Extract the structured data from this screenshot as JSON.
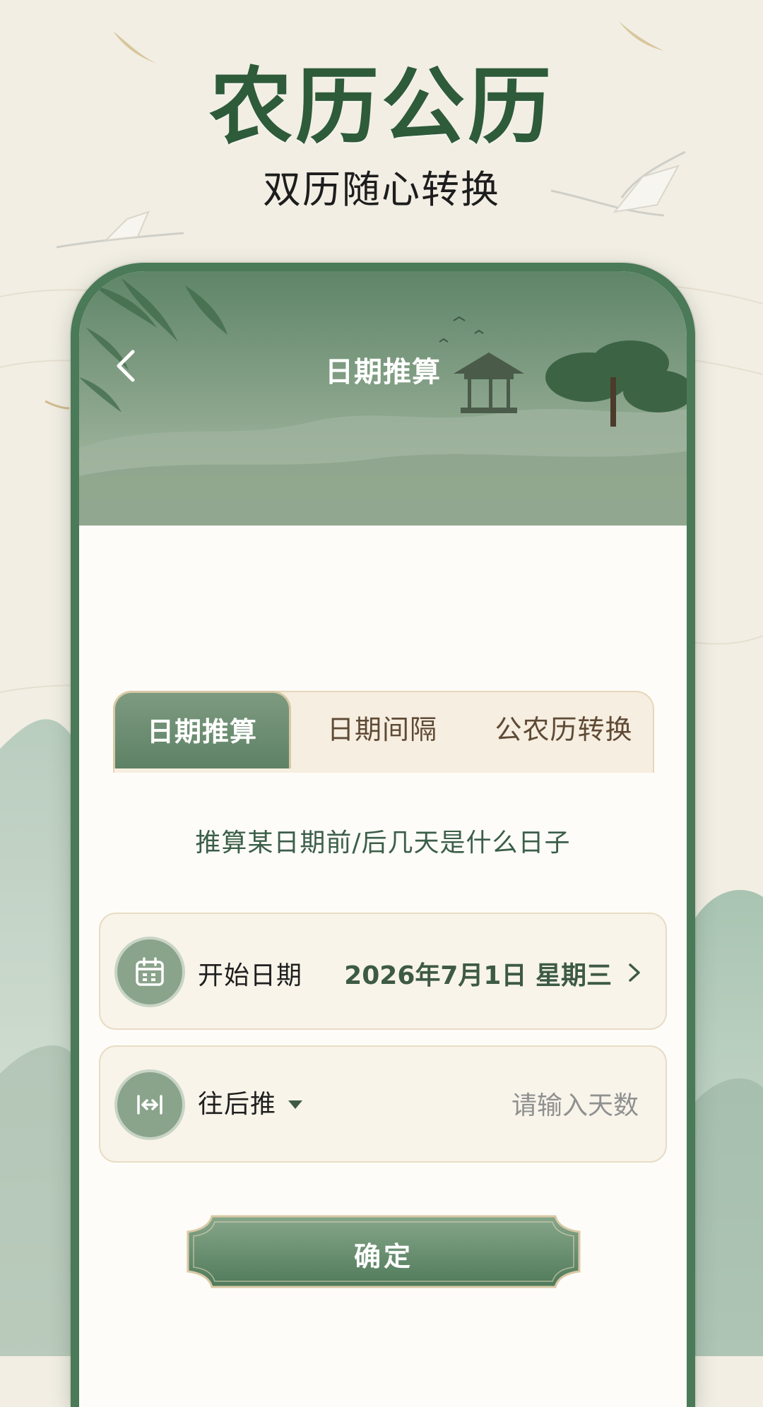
{
  "promo": {
    "title": "农历公历",
    "subtitle": "双历随心转换"
  },
  "nav": {
    "title": "日期推算",
    "back_icon": "chevron-left-icon"
  },
  "tabs": [
    {
      "label": "日期推算",
      "active": true
    },
    {
      "label": "日期间隔",
      "active": false
    },
    {
      "label": "公农历转换",
      "active": false
    }
  ],
  "card": {
    "description": "推算某日期前/后几天是什么日子",
    "start_date": {
      "label": "开始日期",
      "value": "2026年7月1日  星期三",
      "icon": "calendar-icon"
    },
    "direction": {
      "label": "往后推",
      "icon": "arrows-horizontal-icon",
      "input_placeholder": "请输入天数"
    },
    "confirm_label": "确定"
  },
  "colors": {
    "accent_green": "#4a7a57",
    "title_green": "#2e5b3a",
    "cream": "#f8f4ea"
  }
}
